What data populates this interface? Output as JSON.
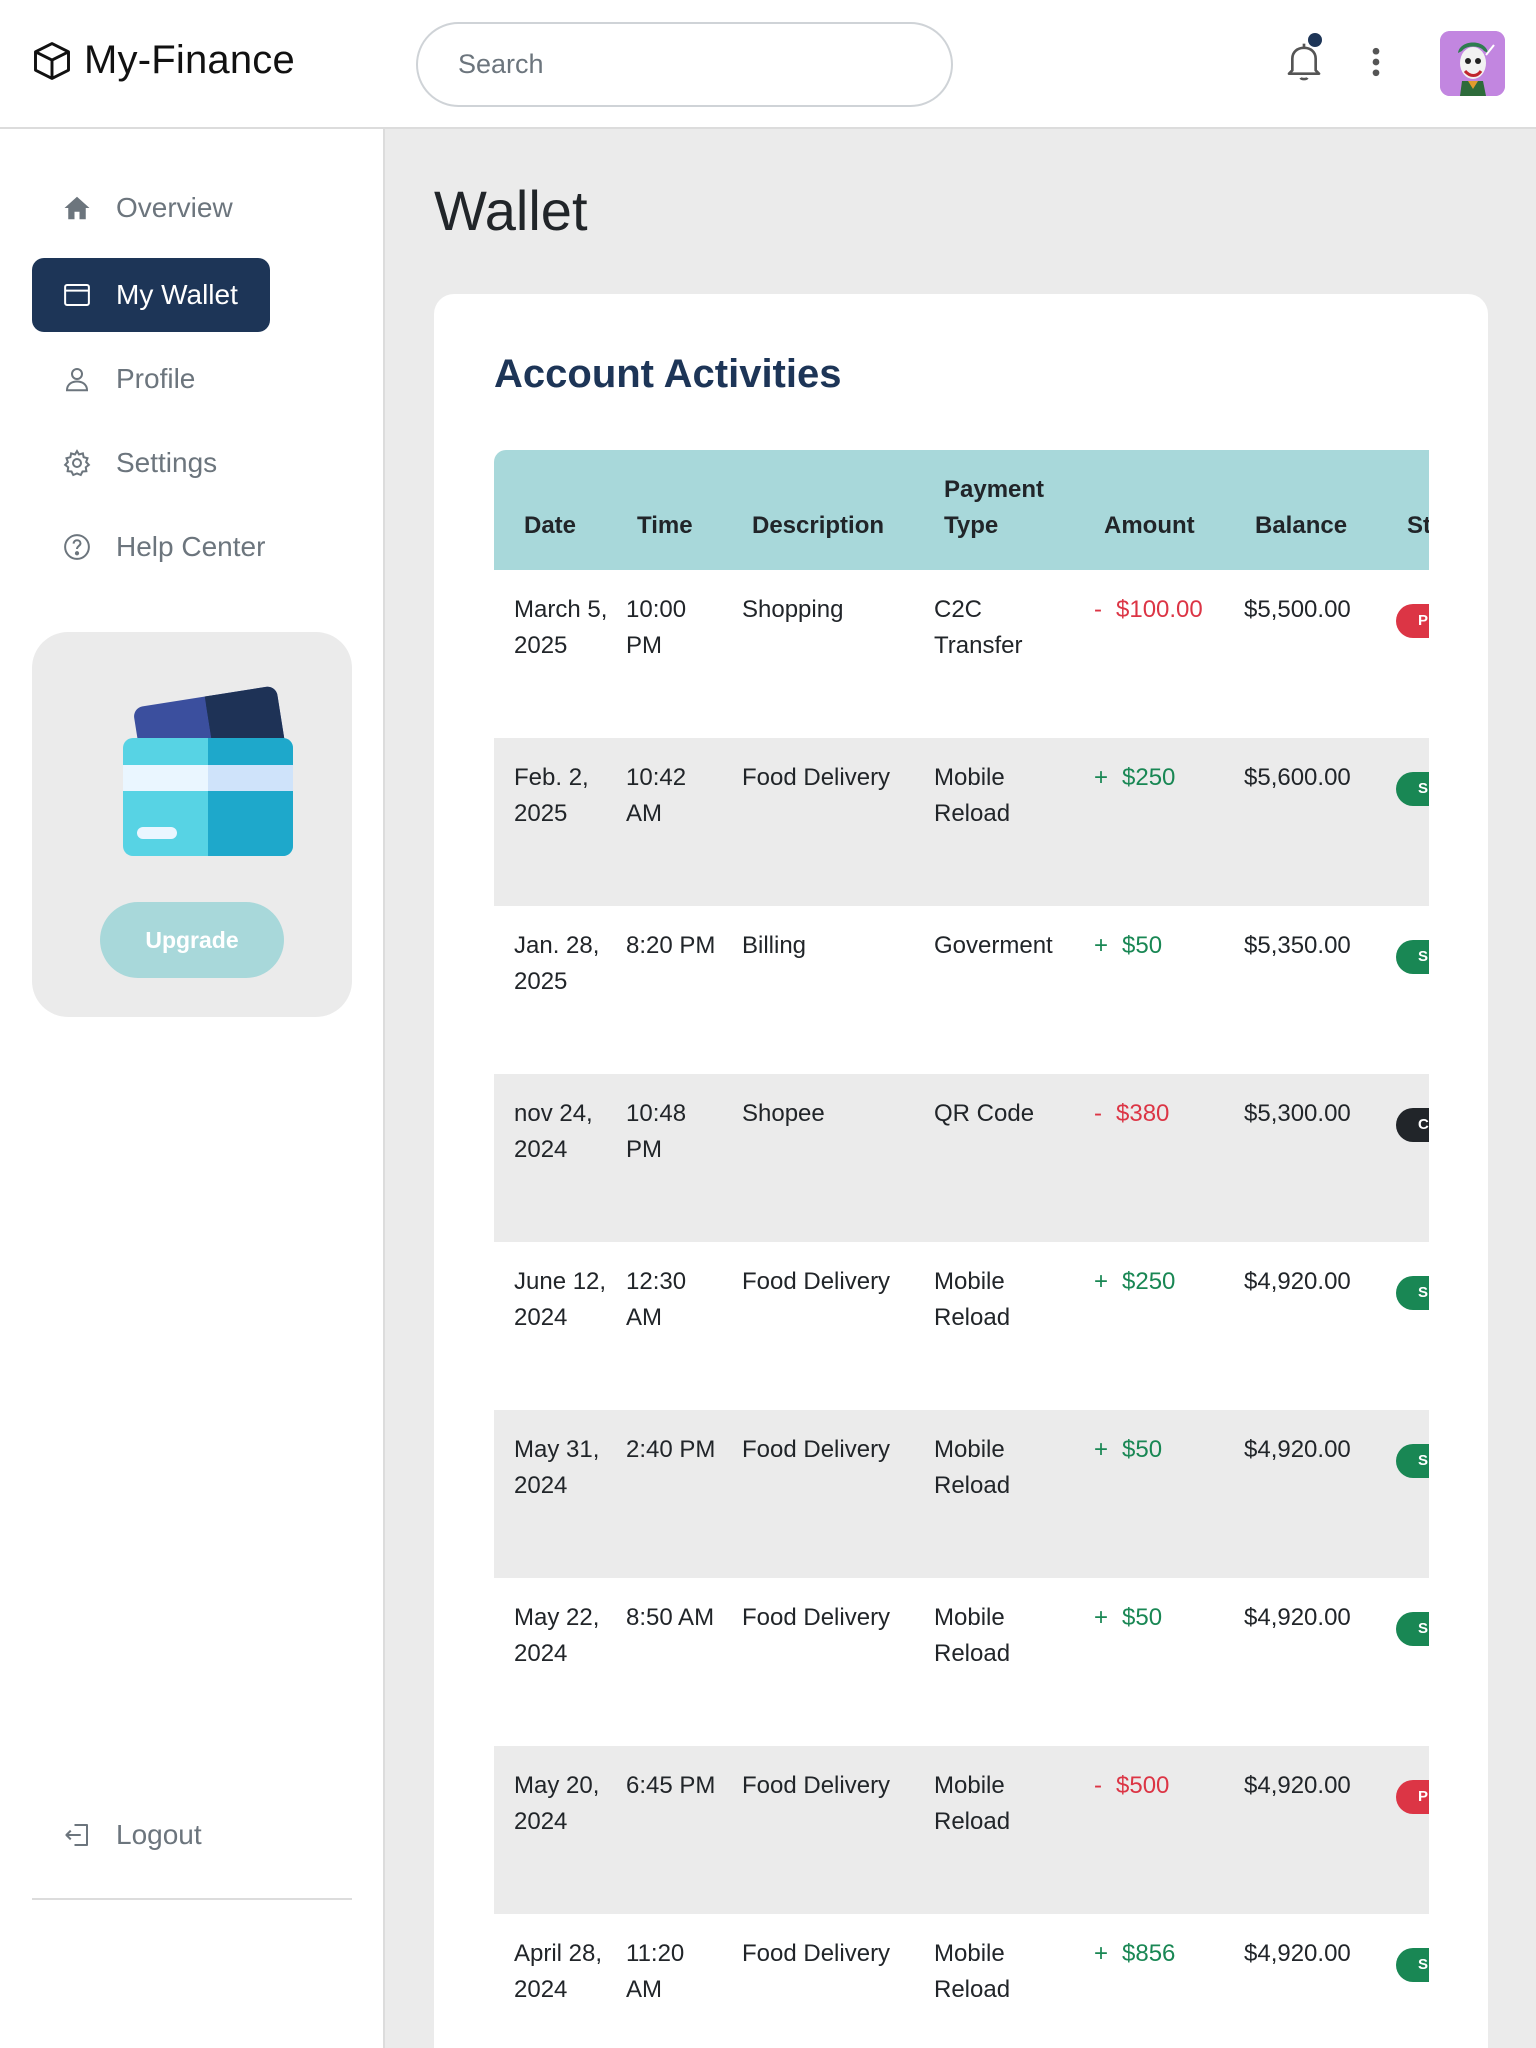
{
  "header": {
    "app_name": "My-Finance",
    "search_placeholder": "Search",
    "notification_dot": true
  },
  "sidebar": {
    "items": [
      {
        "label": "Overview",
        "icon": "home-icon",
        "active": false
      },
      {
        "label": "My Wallet",
        "icon": "wallet-icon",
        "active": true
      },
      {
        "label": "Profile",
        "icon": "user-icon",
        "active": false
      },
      {
        "label": "Settings",
        "icon": "gear-icon",
        "active": false
      },
      {
        "label": "Help Center",
        "icon": "help-icon",
        "active": false
      }
    ],
    "promo": {
      "button_label": "Upgrade"
    },
    "logout_label": "Logout"
  },
  "page": {
    "title": "Wallet"
  },
  "activities": {
    "title": "Account Activities",
    "columns": [
      "Date",
      "Time",
      "Description",
      "Payment Type",
      "Amount",
      "Balance",
      "St"
    ],
    "rows": [
      {
        "date": "March 5, 2025",
        "time": "10:00 PM",
        "description": "Shopping",
        "payment_type": "C2C Transfer",
        "sign": "-",
        "amount": "$100.00",
        "balance": "$5,500.00",
        "status_letter": "P",
        "status_color": "#dc3545"
      },
      {
        "date": "Feb. 2, 2025",
        "time": "10:42 AM",
        "description": "Food Delivery",
        "payment_type": "Mobile Reload",
        "sign": "+",
        "amount": "$250",
        "balance": "$5,600.00",
        "status_letter": "S",
        "status_color": "#198754"
      },
      {
        "date": "Jan. 28, 2025",
        "time": "8:20 PM",
        "description": "Billing",
        "payment_type": "Goverment",
        "sign": "+",
        "amount": "$50",
        "balance": "$5,350.00",
        "status_letter": "S",
        "status_color": "#198754"
      },
      {
        "date": "nov 24, 2024",
        "time": "10:48 PM",
        "description": "Shopee",
        "payment_type": "QR Code",
        "sign": "-",
        "amount": "$380",
        "balance": "$5,300.00",
        "status_letter": "C",
        "status_color": "#212529"
      },
      {
        "date": "June 12, 2024",
        "time": "12:30 AM",
        "description": "Food Delivery",
        "payment_type": "Mobile Reload",
        "sign": "+",
        "amount": "$250",
        "balance": "$4,920.00",
        "status_letter": "S",
        "status_color": "#198754"
      },
      {
        "date": "May 31, 2024",
        "time": "2:40 PM",
        "description": "Food Delivery",
        "payment_type": "Mobile Reload",
        "sign": "+",
        "amount": "$50",
        "balance": "$4,920.00",
        "status_letter": "S",
        "status_color": "#198754"
      },
      {
        "date": "May 22, 2024",
        "time": "8:50 AM",
        "description": "Food Delivery",
        "payment_type": "Mobile Reload",
        "sign": "+",
        "amount": "$50",
        "balance": "$4,920.00",
        "status_letter": "S",
        "status_color": "#198754"
      },
      {
        "date": "May 20, 2024",
        "time": "6:45 PM",
        "description": "Food Delivery",
        "payment_type": "Mobile Reload",
        "sign": "-",
        "amount": "$500",
        "balance": "$4,920.00",
        "status_letter": "P",
        "status_color": "#dc3545"
      },
      {
        "date": "April 28, 2024",
        "time": "11:20 AM",
        "description": "Food Delivery",
        "payment_type": "Mobile Reload",
        "sign": "+",
        "amount": "$856",
        "balance": "$4,920.00",
        "status_letter": "S",
        "status_color": "#198754"
      }
    ]
  },
  "colors": {
    "primary": "#1d3557",
    "accent": "#a8d8da",
    "negative": "#dc3545",
    "positive": "#198754"
  }
}
